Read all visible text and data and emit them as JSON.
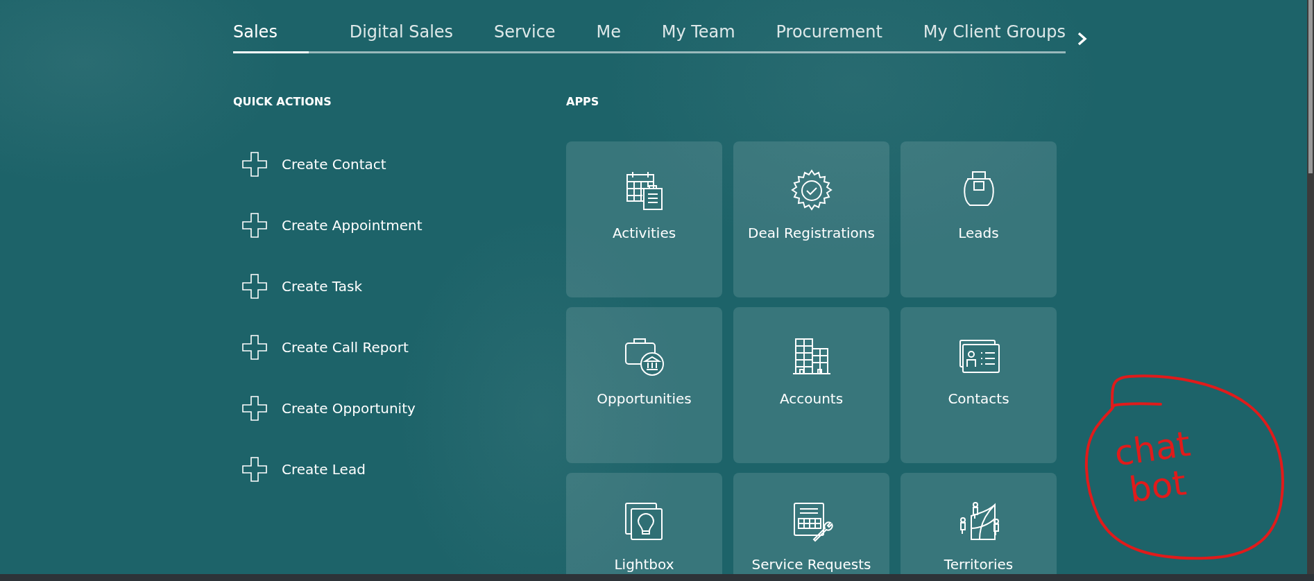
{
  "tabs": [
    {
      "label": "Sales",
      "selected": true
    },
    {
      "label": "Digital Sales",
      "selected": false
    },
    {
      "label": "Service",
      "selected": false
    },
    {
      "label": "Me",
      "selected": false
    },
    {
      "label": "My Team",
      "selected": false
    },
    {
      "label": "Procurement",
      "selected": false
    },
    {
      "label": "My Client Groups",
      "selected": false
    }
  ],
  "quick_actions": {
    "heading": "QUICK ACTIONS",
    "items": [
      "Create Contact",
      "Create Appointment",
      "Create Task",
      "Create Call Report",
      "Create Opportunity",
      "Create Lead"
    ]
  },
  "apps": {
    "heading": "APPS",
    "items": [
      "Activities",
      "Deal Registrations",
      "Leads",
      "Opportunities",
      "Accounts",
      "Contacts",
      "Lightbox",
      "Service Requests",
      "Territories"
    ]
  },
  "annotation": {
    "text": "chat bot"
  }
}
